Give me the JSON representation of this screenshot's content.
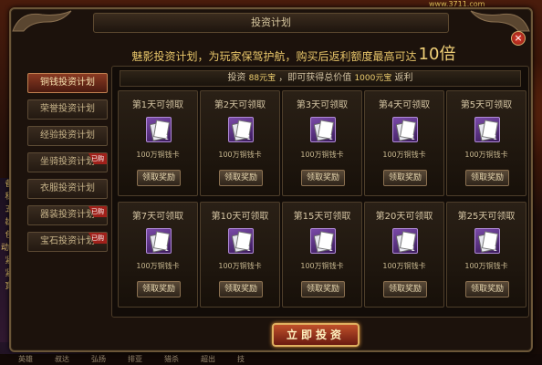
{
  "window": {
    "title": "投资计划",
    "close_glyph": "×"
  },
  "background": {
    "top_right_text": "www.3711.com",
    "left_strip": [
      "备",
      "私",
      "五",
      "雄",
      "色",
      "动了",
      "紧",
      "紧",
      "寶"
    ],
    "bottom_menu": [
      "英雄",
      "叔达",
      "弘扬",
      "排亚",
      "猎杀",
      "超出",
      "技"
    ]
  },
  "headline": {
    "text": "魅影投资计划，为玩家保驾护航，购买后返利额度最高可达",
    "multiplier": "10倍"
  },
  "sidebar": {
    "items": [
      {
        "label": "铜钱投资计划",
        "active": true,
        "badge": ""
      },
      {
        "label": "荣誉投资计划",
        "active": false,
        "badge": ""
      },
      {
        "label": "经验投资计划",
        "active": false,
        "badge": ""
      },
      {
        "label": "坐骑投资计划",
        "active": false,
        "badge": "已购"
      },
      {
        "label": "衣服投资计划",
        "active": false,
        "badge": ""
      },
      {
        "label": "器装投资计划",
        "active": false,
        "badge": "已购"
      },
      {
        "label": "宝石投资计划",
        "active": false,
        "badge": "已购"
      }
    ]
  },
  "invest_bar": {
    "prefix": "投资",
    "amount": "88元宝",
    "middle": "，即可获得总价值",
    "value": "1000元宝",
    "suffix": "返利"
  },
  "rewards": [
    {
      "day": "第1天可领取",
      "item": "100万铜钱卡",
      "qty": "1",
      "button": "领取奖励"
    },
    {
      "day": "第2天可领取",
      "item": "100万铜钱卡",
      "qty": "1",
      "button": "领取奖励"
    },
    {
      "day": "第3天可领取",
      "item": "100万铜钱卡",
      "qty": "1",
      "button": "领取奖励"
    },
    {
      "day": "第4天可领取",
      "item": "100万铜钱卡",
      "qty": "1",
      "button": "领取奖励"
    },
    {
      "day": "第5天可领取",
      "item": "100万铜钱卡",
      "qty": "1",
      "button": "领取奖励"
    },
    {
      "day": "第7天可领取",
      "item": "100万铜钱卡",
      "qty": "1",
      "button": "领取奖励"
    },
    {
      "day": "第10天可领取",
      "item": "100万铜钱卡",
      "qty": "1",
      "button": "领取奖励"
    },
    {
      "day": "第15天可领取",
      "item": "100万铜钱卡",
      "qty": "1",
      "button": "领取奖励"
    },
    {
      "day": "第20天可领取",
      "item": "100万铜钱卡",
      "qty": "1",
      "button": "领取奖励"
    },
    {
      "day": "第25天可领取",
      "item": "100万铜钱卡",
      "qty": "1",
      "button": "领取奖励"
    }
  ],
  "invest_button": "立即投资",
  "colors": {
    "accent_gold": "#f0d078",
    "active_tab": "#8a3a22",
    "item_purple": "#7a4aa8"
  }
}
